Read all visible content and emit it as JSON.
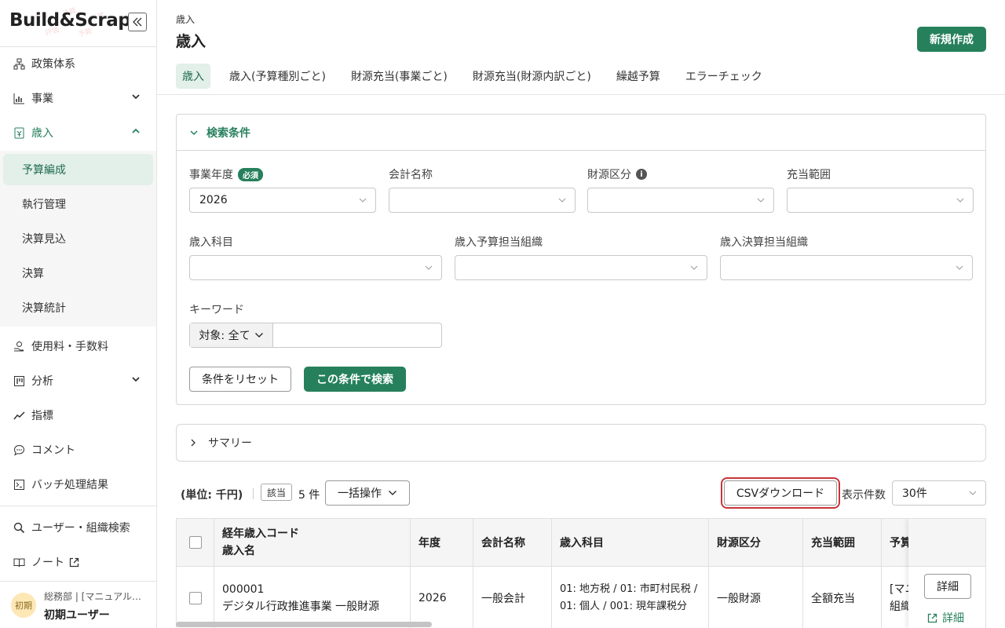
{
  "app": {
    "logo": "Build&Scrap"
  },
  "sidebar": {
    "items": [
      {
        "label": "政策体系",
        "icon": "hierarchy-icon"
      },
      {
        "label": "事業",
        "icon": "bar-chart-icon",
        "chevron": "down"
      },
      {
        "label": "歳入",
        "icon": "revenue-icon",
        "chevron": "up"
      },
      {
        "label": "使用料・手数料",
        "icon": "coin-hand-icon"
      },
      {
        "label": "分析",
        "icon": "analysis-icon",
        "chevron": "down"
      },
      {
        "label": "指標",
        "icon": "trend-icon"
      },
      {
        "label": "コメント",
        "icon": "comment-icon"
      },
      {
        "label": "バッチ処理結果",
        "icon": "terminal-icon"
      },
      {
        "label": "ユーザー・組織検索",
        "icon": "search-icon"
      },
      {
        "label": "ノート",
        "icon": "book-icon"
      }
    ],
    "sub_items": [
      {
        "label": "予算編成"
      },
      {
        "label": "執行管理"
      },
      {
        "label": "決算見込"
      },
      {
        "label": "決算"
      },
      {
        "label": "決算統計"
      }
    ],
    "user": {
      "avatar": "初期",
      "dept": "総務部 | [マニュアル…",
      "name": "初期ユーザー"
    }
  },
  "header": {
    "breadcrumb": "歳入",
    "title": "歳入",
    "new_button": "新規作成",
    "tabs": [
      "歳入",
      "歳入(予算種別ごと)",
      "財源充当(事業ごと)",
      "財源充当(財源内訳ごと)",
      "繰越予算",
      "エラーチェック"
    ]
  },
  "search": {
    "title": "検索条件",
    "fields": {
      "year": {
        "label": "事業年度",
        "required": "必須",
        "value": "2026"
      },
      "account": {
        "label": "会計名称",
        "value": ""
      },
      "source": {
        "label": "財源区分",
        "info": "i",
        "value": ""
      },
      "range": {
        "label": "充当範囲",
        "value": ""
      },
      "subject": {
        "label": "歳入科目",
        "value": ""
      },
      "budget_org": {
        "label": "歳入予算担当組織",
        "value": ""
      },
      "settle_org": {
        "label": "歳入決算担当組織",
        "value": ""
      }
    },
    "keyword": {
      "label": "キーワード",
      "target": "対象: 全て",
      "value": ""
    },
    "reset_button": "条件をリセット",
    "search_button": "この条件で検索"
  },
  "summary": {
    "title": "サマリー"
  },
  "toolbar": {
    "unit": "(単位: 千円)",
    "badge": "該当",
    "count": "5 件",
    "bulk": "一括操作",
    "csv": "CSVダウンロード",
    "per_page_label": "表示件数",
    "per_page": "30件"
  },
  "table": {
    "headers": {
      "code_line1": "経年歳入コード",
      "code_line2": "歳入名",
      "year": "年度",
      "account": "会計名称",
      "subject": "歳入科目",
      "source": "財源区分",
      "range": "充当範囲",
      "budget": "予算"
    },
    "rows": [
      {
        "code": "000001",
        "name": "デジタル行政推進事業 一般財源",
        "year": "2026",
        "account": "一般会計",
        "subject_line1": "01: 地方税 / 01: 市町村民税 /",
        "subject_line2": "01: 個人 / 001: 現年課税分",
        "source": "一般財源",
        "range": "全額充当",
        "budget_line1": "[マニ",
        "budget_line2": "組織",
        "detail_button": "詳細",
        "detail_link": "詳細"
      }
    ]
  }
}
